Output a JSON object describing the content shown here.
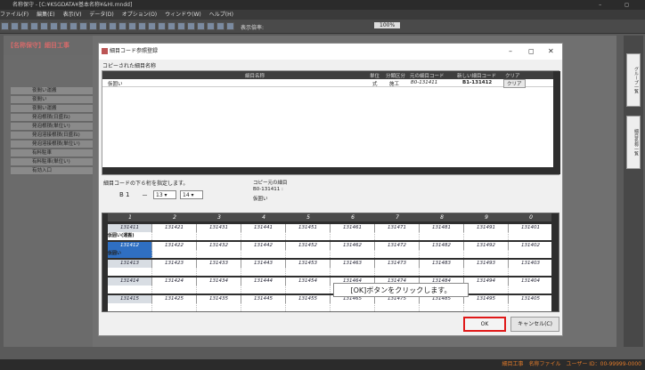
{
  "app": {
    "title": "名称保守 - [C:¥KSGDATA¥基本名称¥&HI.mndd]",
    "menu": [
      "ファイル(F)",
      "編集(E)",
      "表示(V)",
      "データ(D)",
      "オプション(O)",
      "ウィンドウ(W)",
      "ヘルプ(H)"
    ],
    "toolbar_label": "表示倍率:",
    "zoom": "100%",
    "panel_title": "【名称保守】細目工事",
    "status": "細目工事　名称ファイル　ユーザー ID：00-99999-0000",
    "side_tabs": [
      "グループ一覧",
      "細目名称一覧"
    ]
  },
  "bg_rows": [
    "夜間い運搬",
    "夜間い",
    "夜間い運搬",
    "発泡根積(日盛ね)",
    "発泡根積(単位い)",
    "発泡溶接根積(日盛ね)",
    "発泡溶接根積(単位い)",
    "有料駐車",
    "有料駐車(単位い)",
    "有効入口"
  ],
  "dialog": {
    "title": "細目コード参照登録",
    "copy_label": "コピーされた細目名称",
    "list_headers": [
      "細目名称",
      "単位",
      "分類区分",
      "元の細目コード",
      "新しい細目コード",
      "クリア"
    ],
    "row": {
      "name": "仮囲い",
      "unit": "式",
      "cls": "施工",
      "old": "B0-131411",
      "new": "B1-131412",
      "clear": "クリア"
    },
    "instr": "細目コードの下６桁を指定します。",
    "prefix": "B 1",
    "dash": "－",
    "code1": "13",
    "code2": "14",
    "src_label": "コピー元の細目",
    "src_code": "B0-131411 :",
    "src_name": "仮囲い",
    "grid_headers": [
      "1",
      "2",
      "3",
      "4",
      "5",
      "6",
      "7",
      "8",
      "9",
      "0"
    ],
    "grid_rows": [
      [
        "131411",
        "131421",
        "131431",
        "131441",
        "131451",
        "131461",
        "131471",
        "131481",
        "131491",
        "131401"
      ],
      [
        "131412",
        "131422",
        "131432",
        "131442",
        "131452",
        "131462",
        "131472",
        "131482",
        "131492",
        "131402"
      ],
      [
        "131413",
        "131423",
        "131433",
        "131443",
        "131453",
        "131463",
        "131473",
        "131483",
        "131493",
        "131403"
      ],
      [
        "131414",
        "131424",
        "131434",
        "131444",
        "131454",
        "131464",
        "131474",
        "131484",
        "131494",
        "131404"
      ],
      [
        "131415",
        "131425",
        "131435",
        "131445",
        "131455",
        "131465",
        "131475",
        "131485",
        "131495",
        "131405"
      ]
    ],
    "grid_sub": [
      "仮囲い(運搬)",
      "仮囲い"
    ],
    "tooltip": "[OK]ボタンをクリックします。",
    "ok": "OK",
    "cancel": "キャンセル(C)"
  }
}
